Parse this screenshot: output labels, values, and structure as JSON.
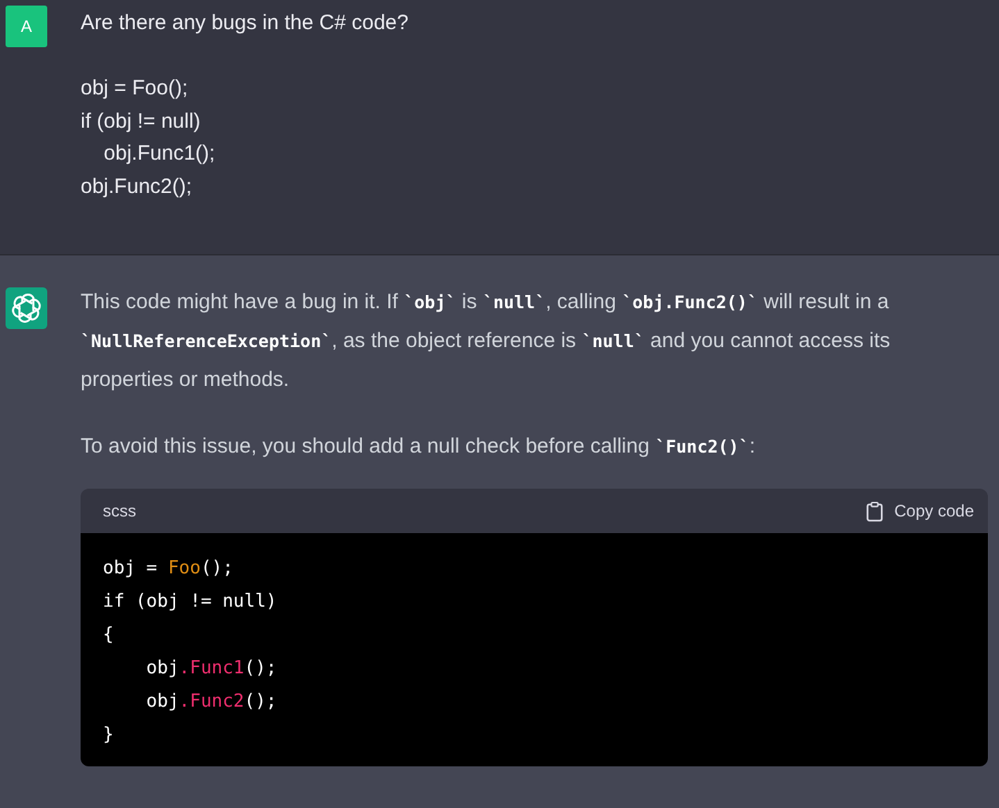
{
  "user_message": {
    "avatar": "A",
    "paragraphs": [
      [
        "Are there any bugs in the C# code?"
      ],
      [
        "obj = Foo();",
        "if (obj != null)",
        "    obj.Func1();",
        "obj.Func2();"
      ]
    ]
  },
  "assistant_message": {
    "paragraphs": [
      [
        {
          "kind": "text",
          "text": "This code might have a bug in it. If "
        },
        {
          "kind": "code",
          "text": "`obj`"
        },
        {
          "kind": "text",
          "text": " is "
        },
        {
          "kind": "code",
          "text": "`null`"
        },
        {
          "kind": "text",
          "text": ", calling "
        },
        {
          "kind": "code",
          "text": "`obj.Func2()`"
        },
        {
          "kind": "text",
          "text": " will result in a "
        },
        {
          "kind": "code",
          "text": "`NullReferenceException`"
        },
        {
          "kind": "text",
          "text": ", as the object reference is "
        },
        {
          "kind": "code",
          "text": "`null`"
        },
        {
          "kind": "text",
          "text": " and you cannot access its properties or methods."
        }
      ],
      [
        {
          "kind": "text",
          "text": "To avoid this issue, you should add a null check before calling "
        },
        {
          "kind": "code",
          "text": "`Func2()`"
        },
        {
          "kind": "text",
          "text": ":"
        }
      ]
    ],
    "code_block": {
      "language": "scss",
      "copy_label": "Copy code",
      "lines": [
        [
          {
            "kind": "plain",
            "text": "obj = "
          },
          {
            "kind": "call",
            "text": "Foo"
          },
          {
            "kind": "plain",
            "text": "();"
          }
        ],
        [
          {
            "kind": "plain",
            "text": "if (obj != null)"
          }
        ],
        [
          {
            "kind": "plain",
            "text": "{"
          }
        ],
        [
          {
            "kind": "plain",
            "text": "    obj"
          },
          {
            "kind": "member",
            "text": ".Func1"
          },
          {
            "kind": "plain",
            "text": "();"
          }
        ],
        [
          {
            "kind": "plain",
            "text": "    obj"
          },
          {
            "kind": "member",
            "text": ".Func2"
          },
          {
            "kind": "plain",
            "text": "();"
          }
        ],
        [
          {
            "kind": "plain",
            "text": "}"
          }
        ]
      ]
    }
  }
}
